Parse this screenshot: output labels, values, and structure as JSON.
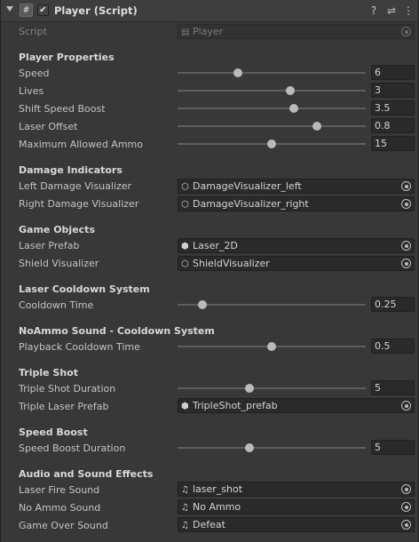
{
  "header": {
    "title": "Player (Script)",
    "script_glyph": "#",
    "check_glyph": "✔",
    "help_glyph": "?",
    "settings_glyph": "⇌",
    "more_glyph": "⋮"
  },
  "script": {
    "label": "Script",
    "value": "Player"
  },
  "sections": {
    "player_properties": "Player Properties",
    "damage_indicators": "Damage Indicators",
    "game_objects": "Game Objects",
    "laser_cooldown": "Laser Cooldown System",
    "noammo_sound": "NoAmmo Sound - Cooldown System",
    "triple_shot": "Triple Shot",
    "speed_boost": "Speed Boost",
    "audio": "Audio and Sound Effects"
  },
  "fields": {
    "speed": {
      "label": "Speed",
      "value": "6",
      "slider_fraction": 0.32
    },
    "lives": {
      "label": "Lives",
      "value": "3",
      "slider_fraction": 0.6
    },
    "shift_speed_boost": {
      "label": "Shift Speed Boost",
      "value": "3.5",
      "slider_fraction": 0.62
    },
    "laser_offset": {
      "label": "Laser Offset",
      "value": "0.8",
      "slider_fraction": 0.74
    },
    "max_ammo": {
      "label": "Maximum Allowed Ammo",
      "value": "15",
      "slider_fraction": 0.5
    },
    "left_damage": {
      "label": "Left Damage Visualizer",
      "value": "DamageVisualizer_left"
    },
    "right_damage": {
      "label": "Right Damage Visualizer",
      "value": "DamageVisualizer_right"
    },
    "laser_prefab": {
      "label": "Laser Prefab",
      "value": "Laser_2D"
    },
    "shield_visualizer": {
      "label": "Shield Visualizer",
      "value": "ShieldVisualizer"
    },
    "cooldown_time": {
      "label": "Cooldown Time",
      "value": "0.25",
      "slider_fraction": 0.13
    },
    "playback_cooldown": {
      "label": "Playback Cooldown Time",
      "value": "0.5",
      "slider_fraction": 0.5
    },
    "triple_shot_duration": {
      "label": "Triple Shot Duration",
      "value": "5",
      "slider_fraction": 0.38
    },
    "triple_laser_prefab": {
      "label": "Triple Laser Prefab",
      "value": "TripleShot_prefab"
    },
    "speed_boost_duration": {
      "label": "Speed Boost Duration",
      "value": "5",
      "slider_fraction": 0.38
    },
    "laser_fire_sound": {
      "label": "Laser Fire Sound",
      "value": "laser_shot"
    },
    "no_ammo_sound": {
      "label": "No Ammo Sound",
      "value": "No Ammo"
    },
    "game_over_sound": {
      "label": "Game Over Sound",
      "value": "Defeat"
    }
  },
  "icons": {
    "script": "▤",
    "gameobject": "⬡",
    "prefab": "⬢",
    "audio": "♫"
  }
}
